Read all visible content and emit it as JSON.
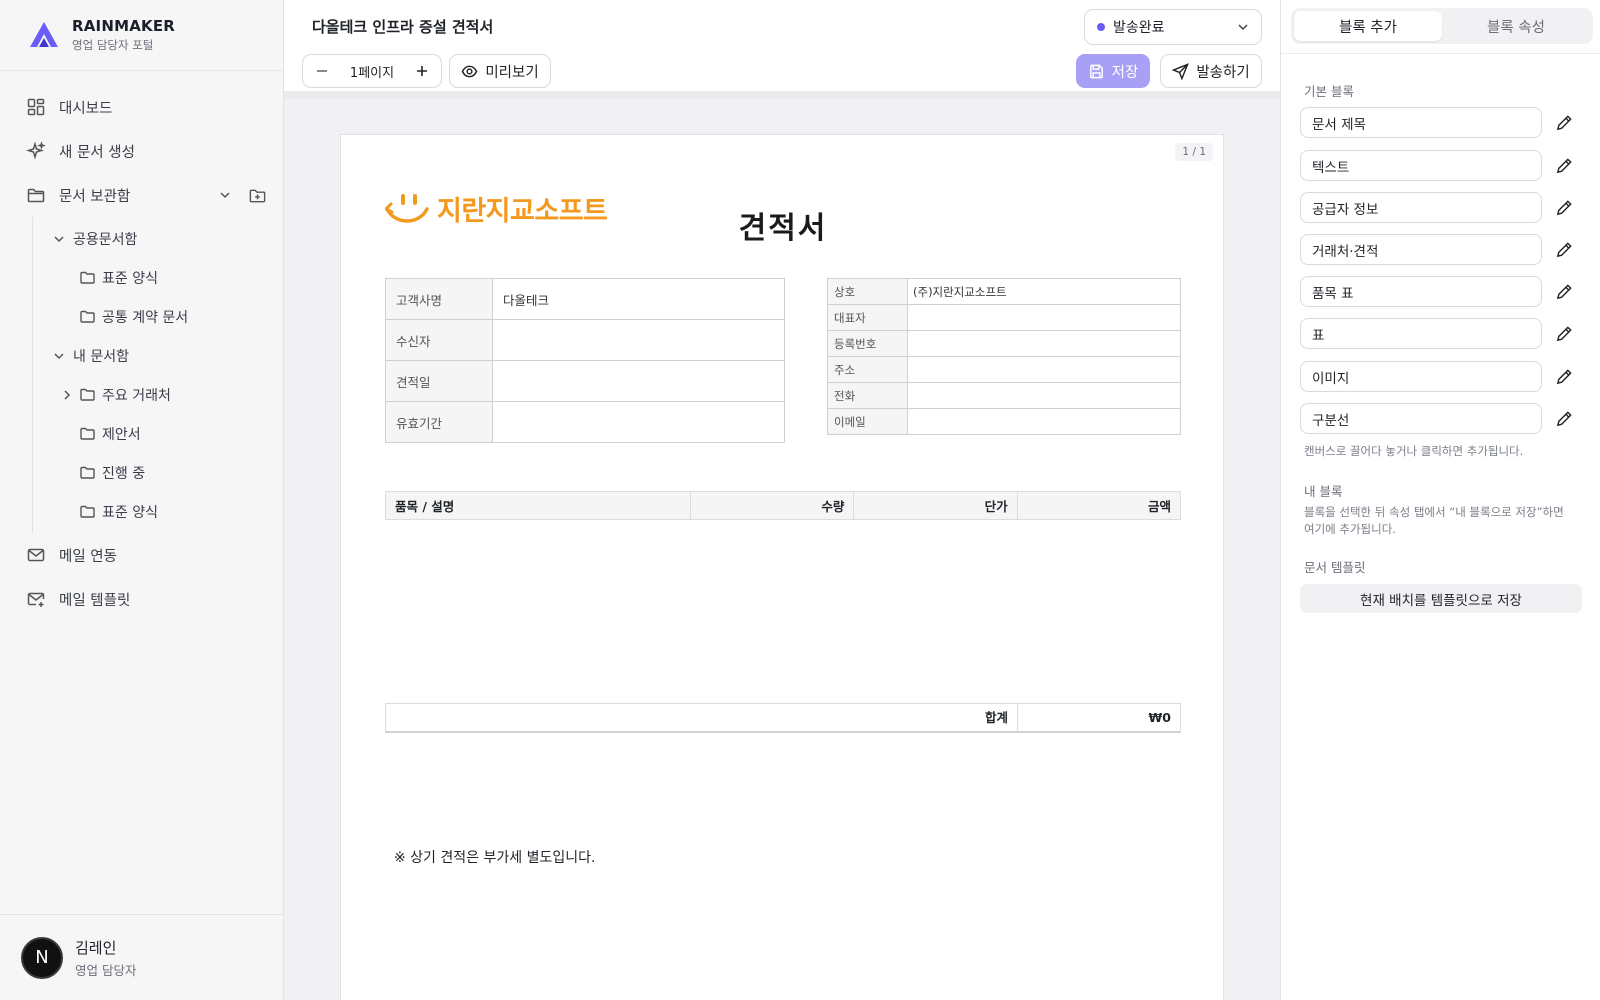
{
  "brand": {
    "name_part1": "RAI",
    "name_part2": "NMAKER",
    "subtitle": "영업 담당자 포털",
    "accent_color": "#6a5cf6"
  },
  "sidebar": {
    "items": [
      {
        "label": "대시보드",
        "icon": "dashboard-icon"
      },
      {
        "label": "새 문서 생성",
        "icon": "sparkle-icon"
      },
      {
        "label": "문서 보관함",
        "icon": "folder-icon"
      }
    ],
    "tree": {
      "shared": {
        "label": "공용문서함",
        "children": [
          "표준 양식",
          "공통 계약 문서"
        ]
      },
      "mine": {
        "label": "내 문서함",
        "children": [
          "주요 거래처",
          "제안서",
          "진행 중",
          "표준 양식"
        ]
      }
    },
    "bottom_items": [
      {
        "label": "메일 연동",
        "icon": "mail-icon"
      },
      {
        "label": "메일 템플릿",
        "icon": "mail-template-icon"
      }
    ]
  },
  "user": {
    "initial": "N",
    "name": "김레인",
    "role": "영업 담당자"
  },
  "toolbar": {
    "doc_title": "다올테크 인프라 증설 견적서",
    "status": "발송완료",
    "status_color": "#6a5cf6",
    "page_label": "1페이지",
    "preview_label": "미리보기",
    "save_label": "저장",
    "send_label": "발송하기"
  },
  "page": {
    "badge": "1 / 1",
    "company_name": "지란지교소프트",
    "company_color": "#f39a1e",
    "heading": "견적서",
    "customer": [
      {
        "key": "고객사명",
        "value": "다올테크"
      },
      {
        "key": "수신자",
        "value": ""
      },
      {
        "key": "견적일",
        "value": ""
      },
      {
        "key": "유효기간",
        "value": ""
      }
    ],
    "supplier": [
      {
        "key": "상호",
        "value": "(주)지란지교소프트"
      },
      {
        "key": "대표자",
        "value": ""
      },
      {
        "key": "등록번호",
        "value": ""
      },
      {
        "key": "주소",
        "value": ""
      },
      {
        "key": "전화",
        "value": ""
      },
      {
        "key": "이메일",
        "value": ""
      }
    ],
    "items_headers": [
      "품목 / 설명",
      "수량",
      "단가",
      "금액"
    ],
    "total_label": "합계",
    "total_value": "₩0",
    "note": "※ 상기 견적은 부가세 별도입니다."
  },
  "right_panel": {
    "tabs": [
      "블록 추가",
      "블록 속성"
    ],
    "basic_label": "기본 블록",
    "blocks": [
      "문서 제목",
      "텍스트",
      "공급자 정보",
      "거래처·견적",
      "품목 표",
      "표",
      "이미지",
      "구분선"
    ],
    "drag_hint": "캔버스로 끌어다 놓거나 클릭하면 추가됩니다.",
    "my_blocks_label": "내 블록",
    "my_blocks_hint": "블록을 선택한 뒤 속성 탭에서 “내 블록으로 저장”하면 여기에 추가됩니다.",
    "templates_label": "문서 템플릿",
    "save_template_label": "현재 배치를 템플릿으로 저장"
  }
}
